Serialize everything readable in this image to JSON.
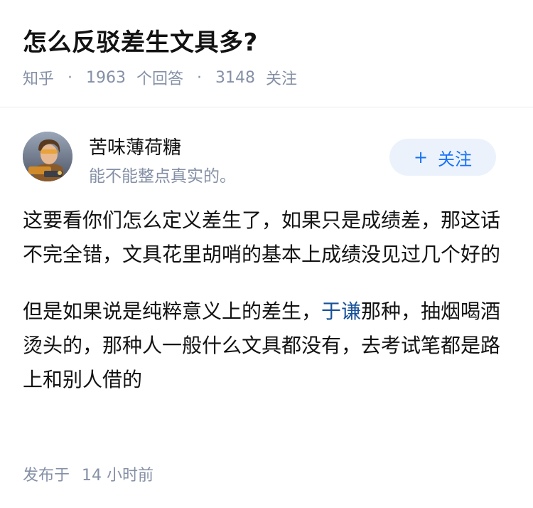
{
  "question": {
    "title": "怎么反驳差生文具多?",
    "source": "知乎",
    "answer_count": "1963",
    "answer_label": "个回答",
    "follower_count": "3148",
    "follower_label": "关注",
    "separator": "·"
  },
  "answer": {
    "author_name": "苦味薄荷糖",
    "author_bio": "能不能整点真实的。",
    "follow_button": "关注",
    "follow_icon": "plus-icon",
    "paragraph1": "这要看你们怎么定义差生了，如果只是成绩差，那这话不完全错，文具花里胡哨的基本上成绩没见过几个好的",
    "paragraph2_before": "但是如果说是纯粹意义上的差生，",
    "paragraph2_link": "于谦",
    "paragraph2_after": "那种，抽烟喝酒烫头的，那种人一般什么文具都没有，去考试笔都是路上和别人借的",
    "published_label": "发布于",
    "published_time": "14 小时前"
  },
  "colors": {
    "primary_text": "#121212",
    "secondary_text": "#8590a6",
    "link": "#175199",
    "follow_bg": "#ebf2fc",
    "follow_text": "#1772f6"
  }
}
